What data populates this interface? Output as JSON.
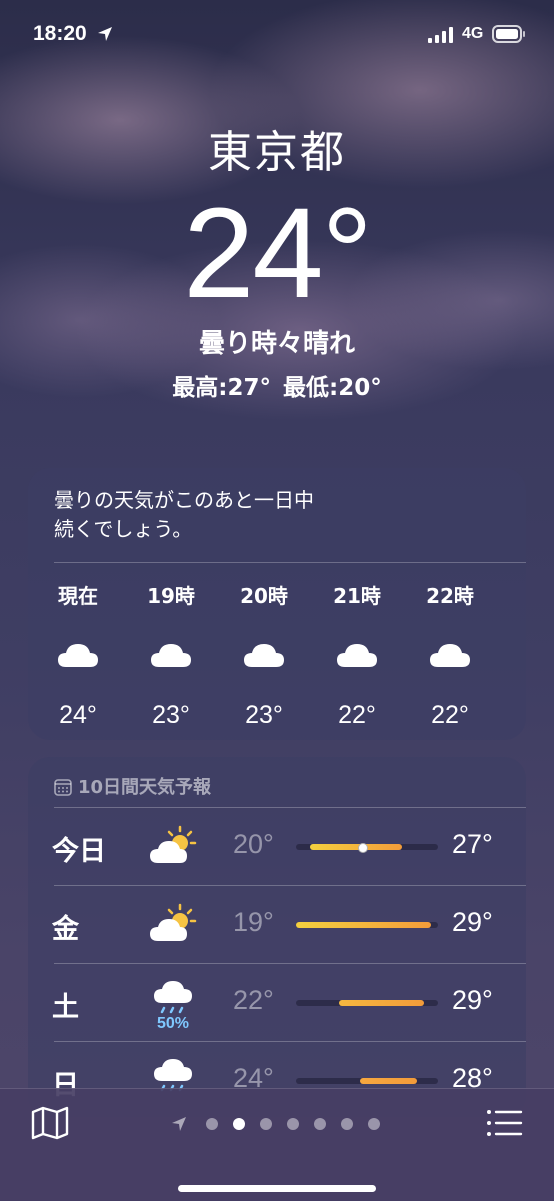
{
  "status": {
    "time": "18:20",
    "network": "4G"
  },
  "current": {
    "city": "東京都",
    "temperature": "24°",
    "condition": "曇り時々晴れ",
    "high": "最高:27°",
    "low": "最低:20°"
  },
  "hourly": {
    "summary_line1": "曇りの天気がこのあと一日中",
    "summary_line2": "続くでしょう。",
    "hours": [
      {
        "label": "現在",
        "icon": "cloud-icon",
        "temp": "24°"
      },
      {
        "label": "19時",
        "icon": "cloud-icon",
        "temp": "23°"
      },
      {
        "label": "20時",
        "icon": "cloud-icon",
        "temp": "23°"
      },
      {
        "label": "21時",
        "icon": "cloud-icon",
        "temp": "22°"
      },
      {
        "label": "22時",
        "icon": "cloud-icon",
        "temp": "22°"
      }
    ]
  },
  "daily": {
    "header": "10日間天気予報",
    "days": [
      {
        "name": "今日",
        "icon": "partly-sunny-icon",
        "low": "20°",
        "high": "27°",
        "pop": "",
        "range_start": 0.1,
        "range_end": 0.75,
        "current": 0.44
      },
      {
        "name": "金",
        "icon": "partly-sunny-icon",
        "low": "19°",
        "high": "29°",
        "pop": "",
        "range_start": 0.0,
        "range_end": 0.95,
        "current": null
      },
      {
        "name": "土",
        "icon": "rain-icon",
        "low": "22°",
        "high": "29°",
        "pop": "50%",
        "range_start": 0.3,
        "range_end": 0.9,
        "current": null
      },
      {
        "name": "日",
        "icon": "rain-icon",
        "low": "24°",
        "high": "28°",
        "pop": "",
        "range_start": 0.45,
        "range_end": 0.85,
        "current": null
      }
    ]
  },
  "pager": {
    "count": 7,
    "active_index": 1
  },
  "colors": {
    "bar_start": "#f4d03f",
    "bar_end": "#f39c3a",
    "precip": "#7fc8ff"
  }
}
